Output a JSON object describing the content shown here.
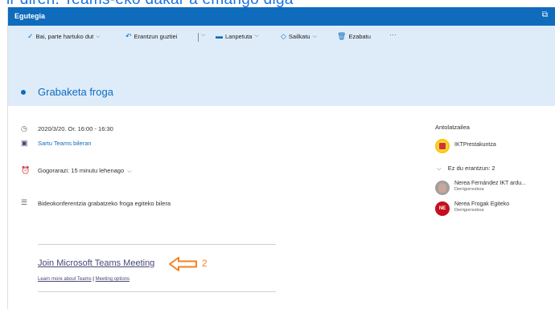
{
  "caption": {
    "text": "ir diren. Teams-eko dakar a emango diga"
  },
  "window": {
    "title": "Egutegia"
  },
  "toolbar": {
    "accept": "Bai, parte hartuko dut",
    "reply_all": "Erantzun guztiei",
    "present": "Lanpetuta",
    "categorize": "Sailkatu",
    "delete": "Ezabatu",
    "more": "···"
  },
  "event": {
    "title": "Grabaketa froga",
    "datetime": "2020/3/20. Or. 16:00 - 16:30",
    "teams_link": "Sartu Teams bileran",
    "reminder": "Gogorarazi: 15 minutu lehenago",
    "description": "Bideokonferentzia grabatzeko froga egiteko bilera"
  },
  "teams_block": {
    "join_label": "Join Microsoft Teams Meeting",
    "learn_more": "Learn more about Teams",
    "separator": "|",
    "meeting_options": "Meeting options"
  },
  "annotation": {
    "number": "2",
    "color": "#f58220"
  },
  "attendees": {
    "organizer_heading": "Antolatzailea",
    "organizer": {
      "name": "IKTPrestakuntza"
    },
    "no_response_label": "Ez du erantzun: 2",
    "people": [
      {
        "name": "Nerea Fernández IKT ardu...",
        "status": "Derrigorrezkoa",
        "initials": ""
      },
      {
        "name": "Nerea Frogak Egiteko",
        "status": "Derrigorrezkoa",
        "initials": "NE"
      }
    ]
  },
  "colors": {
    "accent": "#0f6cbd",
    "band": "#deecf9",
    "teams": "#464775",
    "initials_avatar": "#c50f1f"
  }
}
